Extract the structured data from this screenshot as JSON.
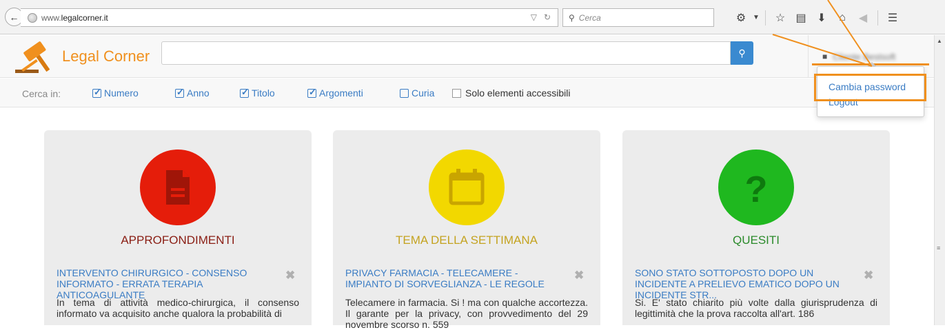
{
  "browser": {
    "url_host": "www.legalcorner.it",
    "url_prefix": "www.",
    "url_domain": "legalcorner.it",
    "search_placeholder": "Cerca"
  },
  "site": {
    "brand": "Legal Corner",
    "user_name": "Cliente Bestsoft",
    "user_menu": {
      "change_password": "Cambia password",
      "logout": "Logout"
    }
  },
  "filters": {
    "label": "Cerca in:",
    "items": [
      {
        "label": "Numero",
        "checked": true
      },
      {
        "label": "Anno",
        "checked": true
      },
      {
        "label": "Titolo",
        "checked": true
      },
      {
        "label": "Argomenti",
        "checked": true
      },
      {
        "label": "Curia",
        "checked": false
      }
    ],
    "accessible_only": "Solo elementi accessibili"
  },
  "cards": [
    {
      "category": "APPROFONDIMENTI",
      "category_color": "#8a1e14",
      "circle_color": "#e51d0a",
      "icon": "document-icon",
      "title": "INTERVENTO CHIRURGICO - CONSENSO INFORMATO - ERRATA TERAPIA ANTICOAGULANTE",
      "excerpt": "In tema di attività medico-chirurgica, il consenso informato va acquisito anche qualora la probabilità di"
    },
    {
      "category": "TEMA DELLA SETTIMANA",
      "category_color": "#c4a320",
      "circle_color": "#f2d800",
      "icon": "calendar-icon",
      "title": "PRIVACY FARMACIA - TELECAMERE - IMPIANTO DI SORVEGLIANZA - LE REGOLE",
      "excerpt": "Telecamere in farmacia. Si ! ma con qualche accortezza. Il garante per la privacy, con provvedimento del 29 novembre scorso n. 559"
    },
    {
      "category": "QUESITI",
      "category_color": "#2a8a2a",
      "circle_color": "#1fb81f",
      "icon": "question-icon",
      "title": "SONO STATO SOTTOPOSTO DOPO UN INCIDENTE A PRELIEVO EMATICO DOPO UN INCIDENTE STR...",
      "excerpt": "Si. E' stato chiarito più volte dalla giurisprudenza di legittimità che la prova raccolta all'art. 186"
    }
  ],
  "colors": {
    "accent": "#f0901e",
    "link": "#3a7cc4",
    "search_button": "#3a8ad0"
  }
}
